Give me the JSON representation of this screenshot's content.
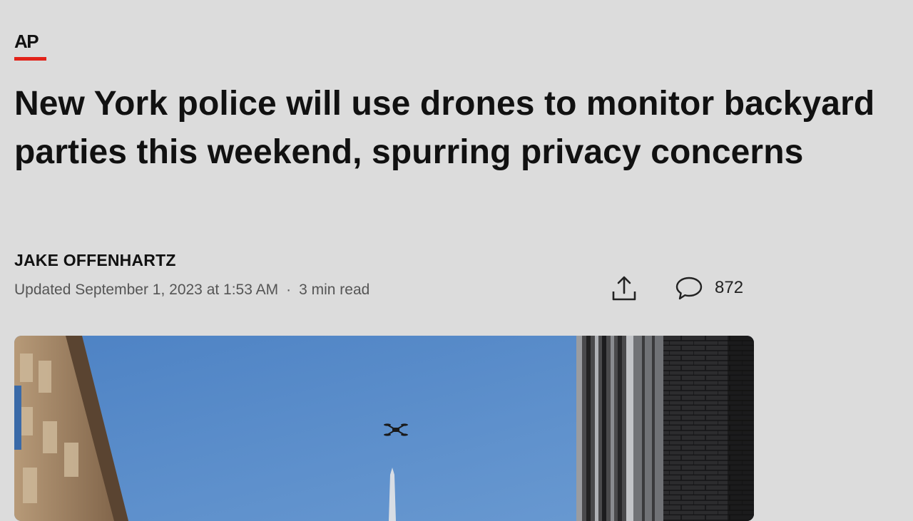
{
  "brand": {
    "logo_text": "AP",
    "accent_color": "#e2231a"
  },
  "article": {
    "headline": "New York police will use drones to monitor backyard parties this weekend, spurring privacy concerns",
    "author": "JAKE OFFENHARTZ",
    "updated": "Updated September 1, 2023 at 1:53 AM",
    "separator": "·",
    "read_time": "3 min read"
  },
  "actions": {
    "share_icon": "share-icon",
    "comment_icon": "comment-icon",
    "comment_count": "872"
  },
  "hero_image": {
    "subject": "drone-over-city-buildings",
    "sky_color": "#5a8cc8"
  }
}
